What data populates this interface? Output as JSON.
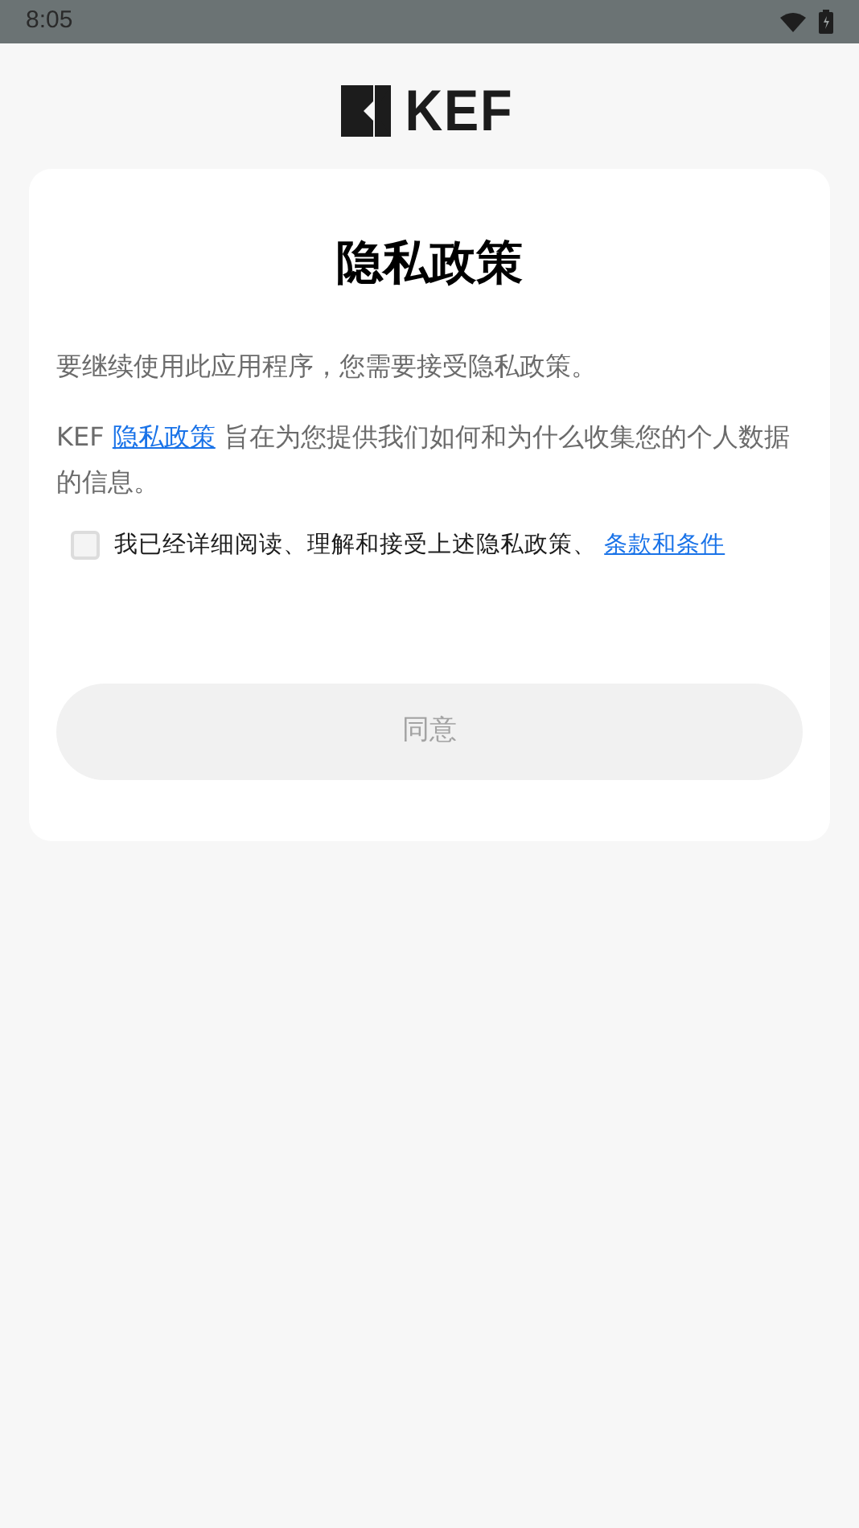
{
  "status_bar": {
    "time": "8:05"
  },
  "logo": {
    "text": "KEF"
  },
  "card": {
    "title": "隐私政策",
    "intro": "要继续使用此应用程序，您需要接受隐私政策。",
    "policy_sentence": {
      "before": "KEF ",
      "link": "隐私政策",
      "after": " 旨在为您提供我们如何和为什么收集您的个人数据的信息。"
    },
    "consent": {
      "checked": false,
      "text": "我已经详细阅读、理解和接受上述隐私政策、 ",
      "link": "条款和条件"
    },
    "agree_button": {
      "label": "同意",
      "disabled": true
    }
  }
}
